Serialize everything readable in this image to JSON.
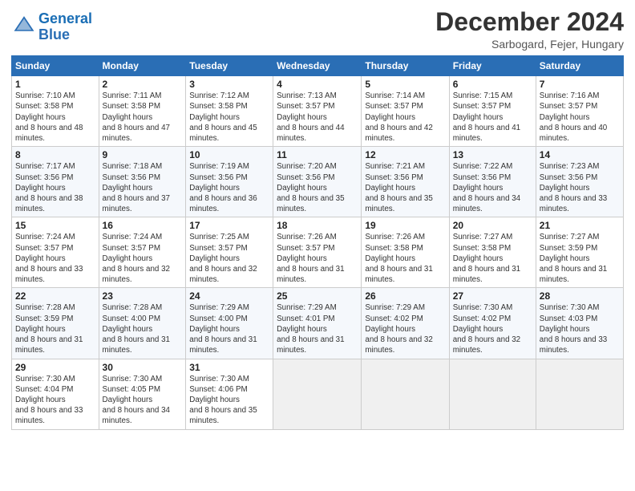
{
  "logo": {
    "line1": "General",
    "line2": "Blue"
  },
  "title": "December 2024",
  "subtitle": "Sarbogard, Fejer, Hungary",
  "days_header": [
    "Sunday",
    "Monday",
    "Tuesday",
    "Wednesday",
    "Thursday",
    "Friday",
    "Saturday"
  ],
  "weeks": [
    [
      {
        "num": "1",
        "rise": "7:10 AM",
        "set": "3:58 PM",
        "daylight": "8 hours and 48 minutes."
      },
      {
        "num": "2",
        "rise": "7:11 AM",
        "set": "3:58 PM",
        "daylight": "8 hours and 47 minutes."
      },
      {
        "num": "3",
        "rise": "7:12 AM",
        "set": "3:58 PM",
        "daylight": "8 hours and 45 minutes."
      },
      {
        "num": "4",
        "rise": "7:13 AM",
        "set": "3:57 PM",
        "daylight": "8 hours and 44 minutes."
      },
      {
        "num": "5",
        "rise": "7:14 AM",
        "set": "3:57 PM",
        "daylight": "8 hours and 42 minutes."
      },
      {
        "num": "6",
        "rise": "7:15 AM",
        "set": "3:57 PM",
        "daylight": "8 hours and 41 minutes."
      },
      {
        "num": "7",
        "rise": "7:16 AM",
        "set": "3:57 PM",
        "daylight": "8 hours and 40 minutes."
      }
    ],
    [
      {
        "num": "8",
        "rise": "7:17 AM",
        "set": "3:56 PM",
        "daylight": "8 hours and 38 minutes."
      },
      {
        "num": "9",
        "rise": "7:18 AM",
        "set": "3:56 PM",
        "daylight": "8 hours and 37 minutes."
      },
      {
        "num": "10",
        "rise": "7:19 AM",
        "set": "3:56 PM",
        "daylight": "8 hours and 36 minutes."
      },
      {
        "num": "11",
        "rise": "7:20 AM",
        "set": "3:56 PM",
        "daylight": "8 hours and 35 minutes."
      },
      {
        "num": "12",
        "rise": "7:21 AM",
        "set": "3:56 PM",
        "daylight": "8 hours and 35 minutes."
      },
      {
        "num": "13",
        "rise": "7:22 AM",
        "set": "3:56 PM",
        "daylight": "8 hours and 34 minutes."
      },
      {
        "num": "14",
        "rise": "7:23 AM",
        "set": "3:56 PM",
        "daylight": "8 hours and 33 minutes."
      }
    ],
    [
      {
        "num": "15",
        "rise": "7:24 AM",
        "set": "3:57 PM",
        "daylight": "8 hours and 33 minutes."
      },
      {
        "num": "16",
        "rise": "7:24 AM",
        "set": "3:57 PM",
        "daylight": "8 hours and 32 minutes."
      },
      {
        "num": "17",
        "rise": "7:25 AM",
        "set": "3:57 PM",
        "daylight": "8 hours and 32 minutes."
      },
      {
        "num": "18",
        "rise": "7:26 AM",
        "set": "3:57 PM",
        "daylight": "8 hours and 31 minutes."
      },
      {
        "num": "19",
        "rise": "7:26 AM",
        "set": "3:58 PM",
        "daylight": "8 hours and 31 minutes."
      },
      {
        "num": "20",
        "rise": "7:27 AM",
        "set": "3:58 PM",
        "daylight": "8 hours and 31 minutes."
      },
      {
        "num": "21",
        "rise": "7:27 AM",
        "set": "3:59 PM",
        "daylight": "8 hours and 31 minutes."
      }
    ],
    [
      {
        "num": "22",
        "rise": "7:28 AM",
        "set": "3:59 PM",
        "daylight": "8 hours and 31 minutes."
      },
      {
        "num": "23",
        "rise": "7:28 AM",
        "set": "4:00 PM",
        "daylight": "8 hours and 31 minutes."
      },
      {
        "num": "24",
        "rise": "7:29 AM",
        "set": "4:00 PM",
        "daylight": "8 hours and 31 minutes."
      },
      {
        "num": "25",
        "rise": "7:29 AM",
        "set": "4:01 PM",
        "daylight": "8 hours and 31 minutes."
      },
      {
        "num": "26",
        "rise": "7:29 AM",
        "set": "4:02 PM",
        "daylight": "8 hours and 32 minutes."
      },
      {
        "num": "27",
        "rise": "7:30 AM",
        "set": "4:02 PM",
        "daylight": "8 hours and 32 minutes."
      },
      {
        "num": "28",
        "rise": "7:30 AM",
        "set": "4:03 PM",
        "daylight": "8 hours and 33 minutes."
      }
    ],
    [
      {
        "num": "29",
        "rise": "7:30 AM",
        "set": "4:04 PM",
        "daylight": "8 hours and 33 minutes."
      },
      {
        "num": "30",
        "rise": "7:30 AM",
        "set": "4:05 PM",
        "daylight": "8 hours and 34 minutes."
      },
      {
        "num": "31",
        "rise": "7:30 AM",
        "set": "4:06 PM",
        "daylight": "8 hours and 35 minutes."
      },
      null,
      null,
      null,
      null
    ]
  ]
}
